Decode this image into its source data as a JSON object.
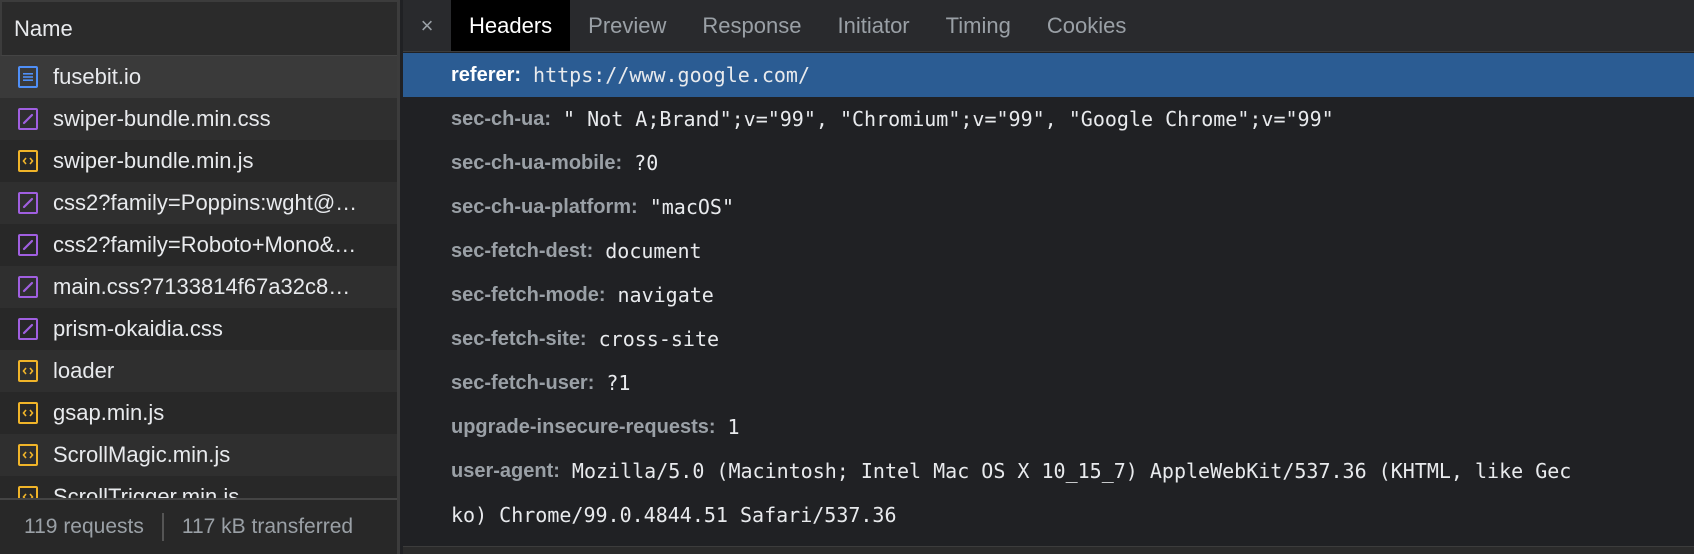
{
  "left_panel": {
    "column_header": "Name",
    "requests": [
      {
        "name": "fusebit.io",
        "type": "doc"
      },
      {
        "name": "swiper-bundle.min.css",
        "type": "css"
      },
      {
        "name": "swiper-bundle.min.js",
        "type": "js"
      },
      {
        "name": "css2?family=Poppins:wght@…",
        "type": "css"
      },
      {
        "name": "css2?family=Roboto+Mono&…",
        "type": "css"
      },
      {
        "name": "main.css?7133814f67a32c8…",
        "type": "css"
      },
      {
        "name": "prism-okaidia.css",
        "type": "css"
      },
      {
        "name": "loader",
        "type": "js"
      },
      {
        "name": "gsap.min.js",
        "type": "js"
      },
      {
        "name": "ScrollMagic.min.js",
        "type": "js"
      },
      {
        "name": "ScrollTrigger.min.js",
        "type": "js"
      }
    ],
    "footer": {
      "requests": "119 requests",
      "transferred": "117 kB transferred"
    }
  },
  "tabs": [
    "Headers",
    "Preview",
    "Response",
    "Initiator",
    "Timing",
    "Cookies"
  ],
  "close_glyph": "×",
  "headers": [
    {
      "key": "referer:",
      "value": "https://www.google.com/"
    },
    {
      "key": "sec-ch-ua:",
      "value": "\" Not A;Brand\";v=\"99\", \"Chromium\";v=\"99\", \"Google Chrome\";v=\"99\""
    },
    {
      "key": "sec-ch-ua-mobile:",
      "value": "?0"
    },
    {
      "key": "sec-ch-ua-platform:",
      "value": "\"macOS\""
    },
    {
      "key": "sec-fetch-dest:",
      "value": "document"
    },
    {
      "key": "sec-fetch-mode:",
      "value": "navigate"
    },
    {
      "key": "sec-fetch-site:",
      "value": "cross-site"
    },
    {
      "key": "sec-fetch-user:",
      "value": "?1"
    },
    {
      "key": "upgrade-insecure-requests:",
      "value": "1"
    },
    {
      "key": "user-agent:",
      "value": "Mozilla/5.0 (Macintosh; Intel Mac OS X 10_15_7) AppleWebKit/537.36 (KHTML, like Gec"
    }
  ],
  "user_agent_continuation": "ko) Chrome/99.0.4844.51 Safari/537.36",
  "colors": {
    "selected_row": "#2b5c93",
    "doc_icon": "#4f8ff7",
    "css_icon": "#a05fe0",
    "js_icon": "#f0b429"
  }
}
